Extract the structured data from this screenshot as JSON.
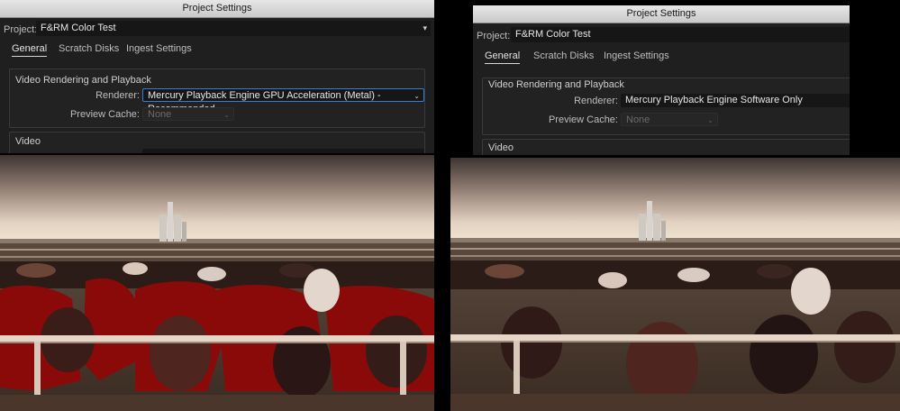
{
  "left_panel": {
    "title": "Project Settings",
    "project_label": "Project:",
    "project_name": "F&RM Color Test",
    "tabs": [
      "General",
      "Scratch Disks",
      "Ingest Settings"
    ],
    "section_title": "Video Rendering and Playback",
    "renderer_label": "Renderer:",
    "renderer_value": "Mercury Playback Engine GPU Acceleration (Metal) - Recommended",
    "preview_cache_label": "Preview Cache:",
    "preview_cache_value": "None",
    "video_section_title": "Video"
  },
  "right_panel": {
    "title": "Project Settings",
    "project_label": "Project:",
    "project_name": "F&RM Color Test",
    "tabs": [
      "General",
      "Scratch Disks",
      "Ingest Settings"
    ],
    "section_title": "Video Rendering and Playback",
    "renderer_label": "Renderer:",
    "renderer_value": "Mercury Playback Engine Software Only",
    "preview_cache_label": "Preview Cache:",
    "preview_cache_value": "None",
    "video_section_title": "Video"
  },
  "icons": {
    "dropdown": "chevron-down-icon"
  },
  "colors": {
    "focus_blue": "#2f7fd8",
    "artifact_red": "#8a0a0a"
  }
}
